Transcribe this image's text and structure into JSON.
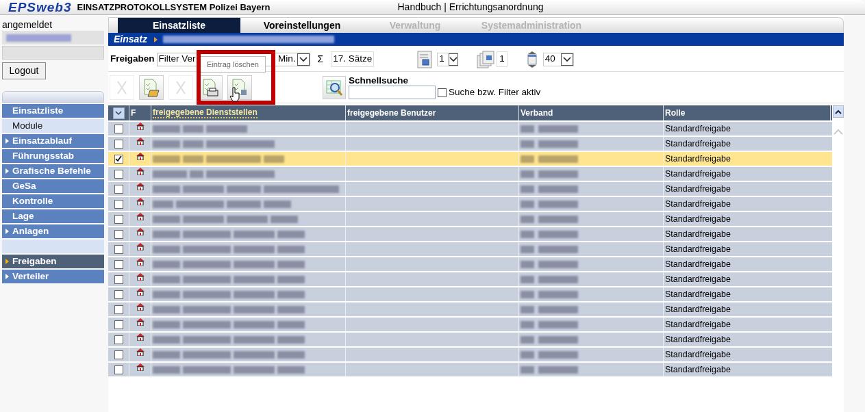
{
  "header": {
    "logo": "EPSweb3",
    "title": "EINSATZPROTOKOLLSYSTEM Polizei Bayern",
    "links": "Handbuch | Errichtungsanordnung"
  },
  "login": {
    "label": "angemeldet",
    "button": "Logout"
  },
  "sidebar": {
    "items": [
      {
        "label": "Einsatzliste",
        "kind": "section",
        "expandable": false,
        "selected": false
      },
      {
        "label": "Module",
        "kind": "subheader",
        "expandable": false,
        "selected": false
      },
      {
        "label": "Einsatzablauf",
        "kind": "section",
        "expandable": true,
        "selected": false
      },
      {
        "label": "Führungsstab",
        "kind": "section",
        "expandable": false,
        "selected": false
      },
      {
        "label": "Grafische Befehle",
        "kind": "section",
        "expandable": true,
        "selected": false
      },
      {
        "label": "GeSa",
        "kind": "section",
        "expandable": false,
        "selected": false
      },
      {
        "label": "Kontrolle",
        "kind": "section",
        "expandable": false,
        "selected": false
      },
      {
        "label": "Lage",
        "kind": "section",
        "expandable": false,
        "selected": false
      },
      {
        "label": "Anlagen",
        "kind": "section",
        "expandable": true,
        "selected": false
      },
      {
        "kind": "spacer"
      },
      {
        "label": "Freigaben",
        "kind": "section",
        "expandable": true,
        "selected": true
      },
      {
        "label": "Verteiler",
        "kind": "section",
        "expandable": true,
        "selected": false
      }
    ]
  },
  "tabs": [
    {
      "label": "Einsatzliste",
      "selected": true,
      "disabled": false
    },
    {
      "label": "Voreinstellungen",
      "selected": false,
      "disabled": false
    },
    {
      "label": "Verwaltung",
      "selected": false,
      "disabled": true
    },
    {
      "label": "Systemadministration",
      "selected": false,
      "disabled": true
    }
  ],
  "breadcrumb": {
    "title": "Einsatz"
  },
  "filter_bar": {
    "title": "Freigaben",
    "filter_text": "Filter Ver",
    "unit": "Min.",
    "sigma": "Σ",
    "count": "17. Sätze",
    "page": "1",
    "pages": "1",
    "page_size": "40"
  },
  "toolbar": {
    "buttons": [
      {
        "kind": "delete",
        "disabled": true
      },
      {
        "kind": "open",
        "disabled": false
      },
      {
        "kind": "delete",
        "disabled": true
      },
      {
        "kind": "print",
        "disabled": false
      },
      {
        "kind": "list",
        "disabled": false
      }
    ],
    "quick_search": "Schnellsuche",
    "filter_checkbox": {
      "label": "Suche bzw. Filter aktiv",
      "checked": false
    }
  },
  "tooltip": "Eintrag löschen",
  "table": {
    "columns": [
      "F",
      "freigegebene Dienststellen",
      "freigegebene Benutzer",
      "Verband",
      "Rolle"
    ],
    "rows": [
      {
        "checked": false,
        "role": "Standardfreigabe"
      },
      {
        "checked": false,
        "role": "Standardfreigabe"
      },
      {
        "checked": true,
        "role": "Standardfreigabe"
      },
      {
        "checked": false,
        "role": "Standardfreigabe"
      },
      {
        "checked": false,
        "role": "Standardfreigabe"
      },
      {
        "checked": false,
        "role": "Standardfreigabe"
      },
      {
        "checked": false,
        "role": "Standardfreigabe"
      },
      {
        "checked": false,
        "role": "Standardfreigabe"
      },
      {
        "checked": false,
        "role": "Standardfreigabe"
      },
      {
        "checked": false,
        "role": "Standardfreigabe"
      },
      {
        "checked": false,
        "role": "Standardfreigabe"
      },
      {
        "checked": false,
        "role": "Standardfreigabe"
      },
      {
        "checked": false,
        "role": "Standardfreigabe"
      },
      {
        "checked": false,
        "role": "Standardfreigabe"
      },
      {
        "checked": false,
        "role": "Standardfreigabe"
      },
      {
        "checked": false,
        "role": "Standardfreigabe"
      },
      {
        "checked": false,
        "role": "Standardfreigabe"
      }
    ]
  }
}
